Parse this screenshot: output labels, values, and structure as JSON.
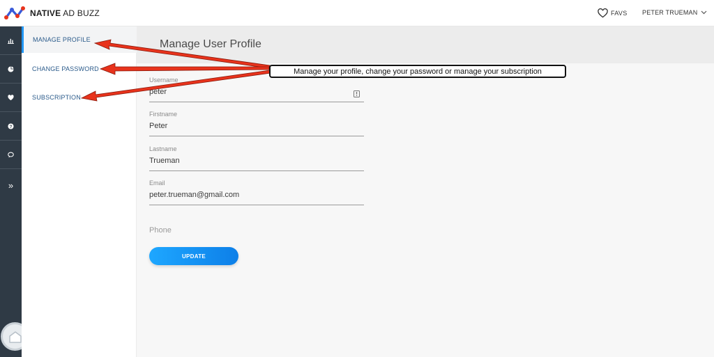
{
  "brand": {
    "name_bold": "NATIVE",
    "name_rest": " AD BUZZ"
  },
  "topbar": {
    "favs_label": "FAVS",
    "user_name": "PETER TRUEMAN"
  },
  "rail": {
    "icons": [
      "bar-chart-icon",
      "pie-chart-icon",
      "heart-icon",
      "help-icon",
      "chat-icon"
    ],
    "expand_glyph": "»"
  },
  "submenu": {
    "items": [
      {
        "label": "MANAGE PROFILE",
        "active": true
      },
      {
        "label": "CHANGE PASSWORD",
        "active": false
      },
      {
        "label": "SUBSCRIPTION",
        "active": false
      }
    ]
  },
  "page": {
    "title": "Manage User Profile"
  },
  "form": {
    "username": {
      "label": "Username",
      "value": "peter"
    },
    "firstname": {
      "label": "Firstname",
      "value": "Peter"
    },
    "lastname": {
      "label": "Lastname",
      "value": "Trueman"
    },
    "email": {
      "label": "Email",
      "value": "peter.trueman@gmail.com"
    },
    "phone": {
      "label": "Phone",
      "value": ""
    },
    "update_label": "UPDATE"
  },
  "annotation": {
    "text": "Manage your profile, change your password or manage your subscription"
  },
  "colors": {
    "accent": "#2196f3",
    "rail": "#2f3a45",
    "arrow": "#e8331c",
    "link": "#2a5a8a"
  }
}
